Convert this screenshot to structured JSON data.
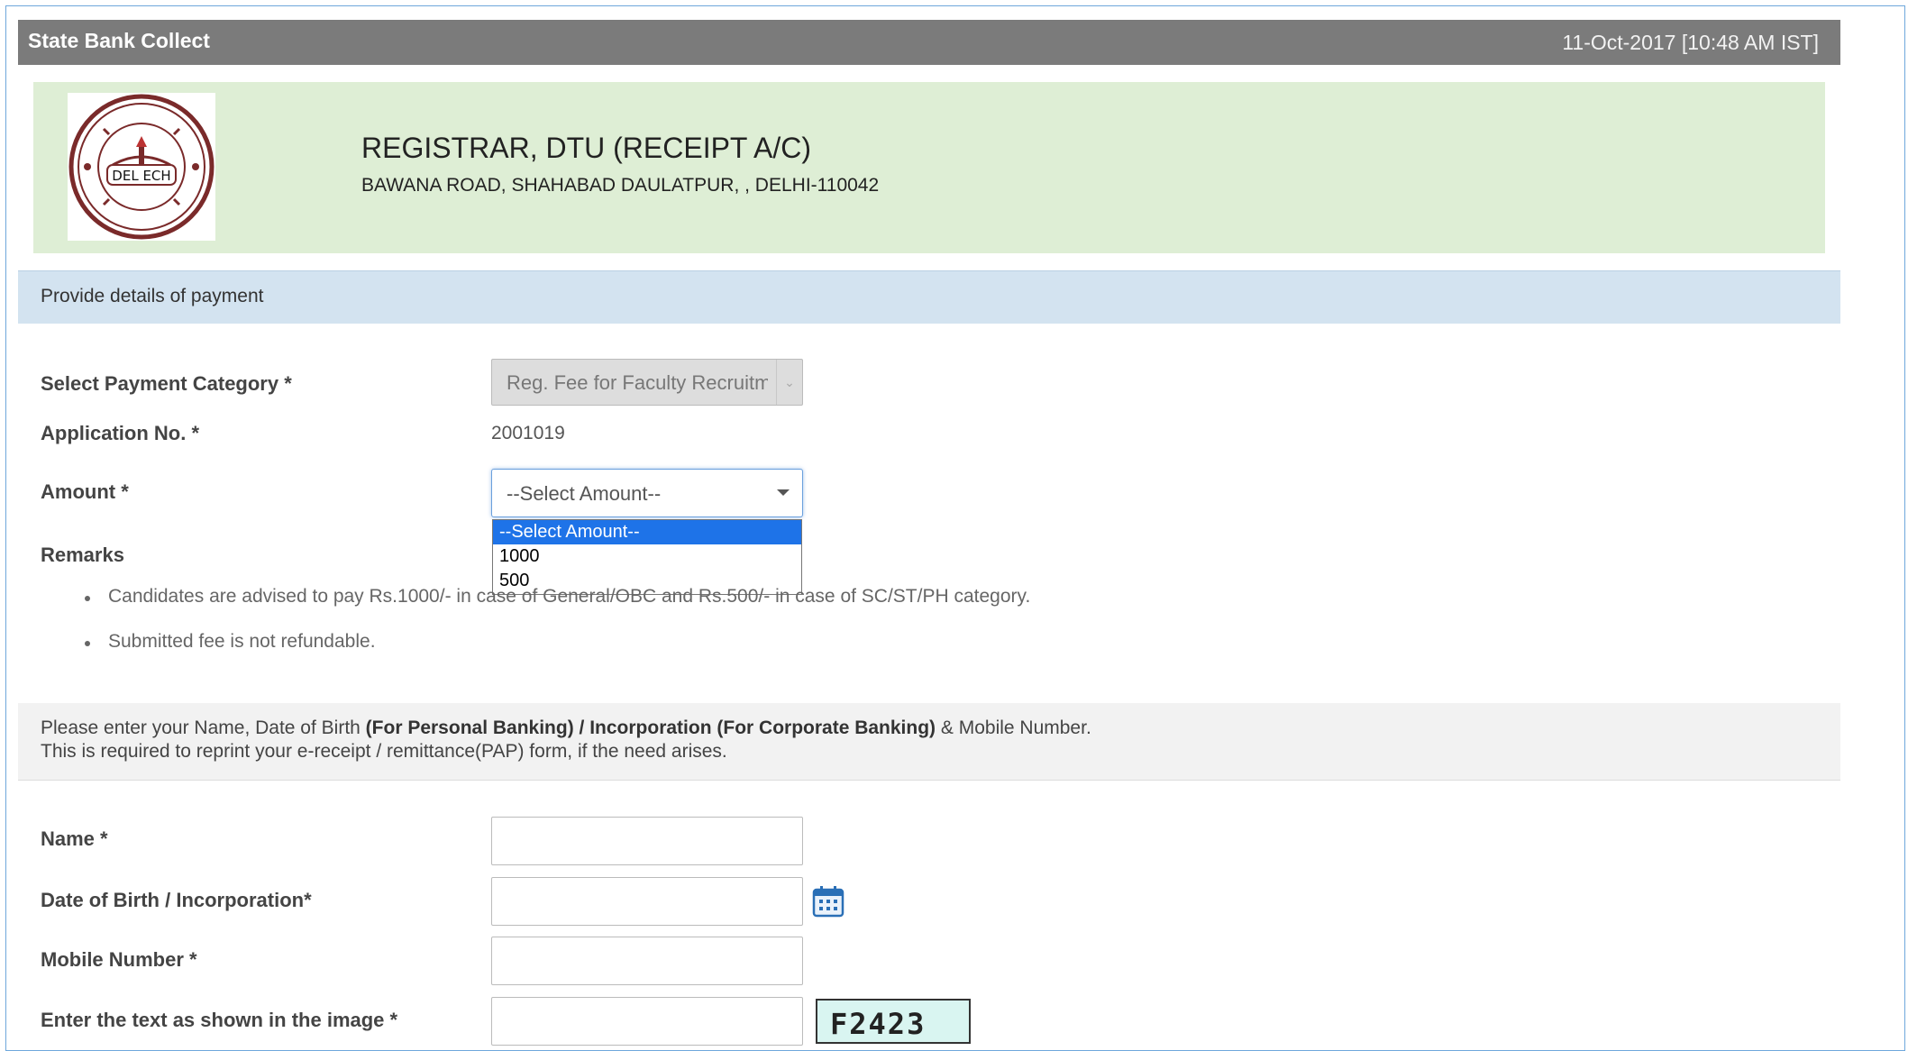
{
  "titlebar": {
    "app_name": "State Bank Collect",
    "timestamp": "11-Oct-2017 [10:48 AM IST]"
  },
  "merchant": {
    "logo_icon": "delhi-technological-university-seal",
    "name": "REGISTRAR, DTU (RECEIPT A/C)",
    "address": "BAWANA ROAD, SHAHABAD DAULATPUR, , DELHI-110042"
  },
  "section": {
    "title": "Provide details of payment"
  },
  "form": {
    "category_label": "Select Payment Category *",
    "category_value": "Reg. Fee for Faculty Recruitment",
    "application_label": "Application No. *",
    "application_value": "2001019",
    "amount_label": "Amount *",
    "amount_value": "--Select Amount--",
    "amount_options": [
      "--Select Amount--",
      "1000",
      "500"
    ],
    "remarks_label": "Remarks",
    "remarks": [
      "Candidates are advised to pay Rs.1000/- in case of General/OBC and Rs.500/- in case of SC/ST/PH category.",
      "Submitted fee is not refundable."
    ]
  },
  "info": {
    "line1_a": "Please enter your Name, Date of Birth ",
    "line1_b": "(For Personal Banking) / Incorporation (For Corporate Banking)",
    "line1_c": " & Mobile Number.",
    "line2": "This is required to reprint your e-receipt / remittance(PAP) form, if the need arises."
  },
  "personal": {
    "name_label": "Name *",
    "dob_label": "Date of Birth / Incorporation*",
    "mobile_label": "Mobile Number *",
    "captcha_label": "Enter the text as shown in the image *",
    "captcha_text": "F2423",
    "calendar_icon": "calendar-icon"
  }
}
